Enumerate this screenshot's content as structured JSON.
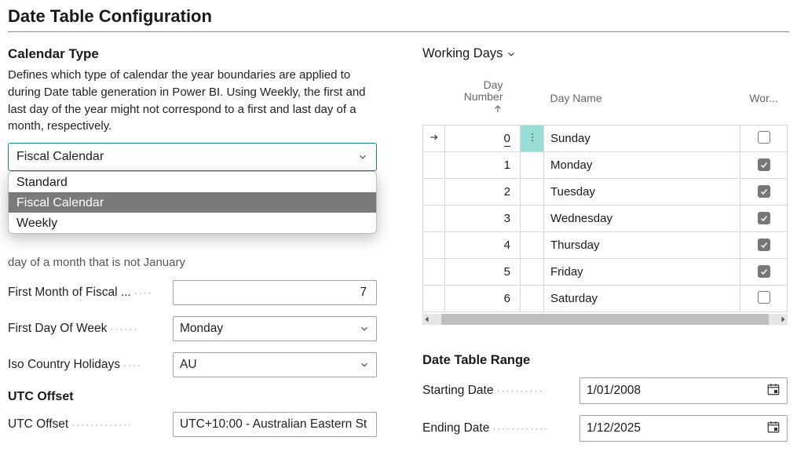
{
  "page_title": "Date Table Configuration",
  "left": {
    "calendar_type": {
      "heading": "Calendar Type",
      "description": "Defines which type of calendar the year boundaries are applied to during Date table generation in Power BI. Using Weekly, the first and last day of the year might not correspond to a first and last day of a month, respectively.",
      "value": "Fiscal Calendar",
      "options": [
        "Standard",
        "Fiscal Calendar",
        "Weekly"
      ]
    },
    "partial_text": "day of a month that is not January",
    "first_month_label": "First Month of Fiscal ...",
    "first_month_value": "7",
    "first_day_label": "First Day Of Week",
    "first_day_value": "Monday",
    "iso_label": "Iso Country Holidays",
    "iso_value": "AU",
    "utc_heading": "UTC Offset",
    "utc_label": "UTC Offset",
    "utc_value": "UTC+10:00 - Australian Eastern St"
  },
  "right": {
    "heading": "Working Days",
    "columns": {
      "num": "Day Number",
      "name": "Day Name",
      "work": "Wor..."
    },
    "rows": [
      {
        "num": "0",
        "name": "Sunday",
        "work": false,
        "selected": true
      },
      {
        "num": "1",
        "name": "Monday",
        "work": true
      },
      {
        "num": "2",
        "name": "Tuesday",
        "work": true
      },
      {
        "num": "3",
        "name": "Wednesday",
        "work": true
      },
      {
        "num": "4",
        "name": "Thursday",
        "work": true
      },
      {
        "num": "5",
        "name": "Friday",
        "work": true
      },
      {
        "num": "6",
        "name": "Saturday",
        "work": false
      }
    ],
    "range": {
      "heading": "Date Table Range",
      "start_label": "Starting Date",
      "start_value": "1/01/2008",
      "end_label": "Ending Date",
      "end_value": "1/12/2025"
    }
  }
}
